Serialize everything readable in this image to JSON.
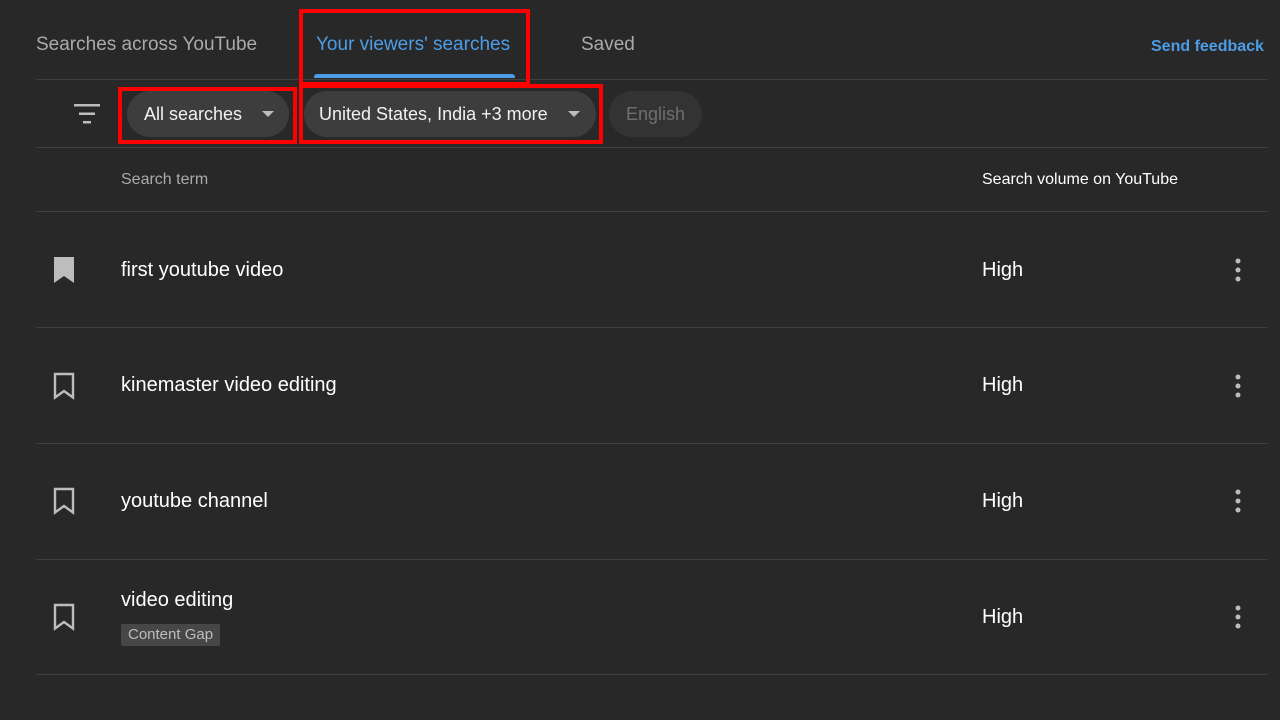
{
  "tabs": {
    "across": "Searches across YouTube",
    "viewers": "Your viewers' searches",
    "saved": "Saved",
    "active": "viewers"
  },
  "send_feedback": "Send feedback",
  "filters": {
    "icon": "filter-list-icon",
    "search_type": "All searches",
    "countries": "United States, India +3 more",
    "language": "English",
    "language_disabled": true
  },
  "table": {
    "columns": {
      "term": "Search term",
      "volume": "Search volume on YouTube"
    },
    "rows": [
      {
        "term": "first youtube video",
        "volume": "High",
        "saved": true,
        "tag": ""
      },
      {
        "term": "kinemaster video editing",
        "volume": "High",
        "saved": false,
        "tag": ""
      },
      {
        "term": "youtube channel",
        "volume": "High",
        "saved": false,
        "tag": ""
      },
      {
        "term": "video editing",
        "volume": "High",
        "saved": false,
        "tag": "Content Gap"
      }
    ]
  },
  "colors": {
    "background": "#282828",
    "accent": "#4d9de6",
    "highlight": "#ff0000",
    "chip": "#3d3d3d",
    "divider": "#3f3f3f"
  }
}
